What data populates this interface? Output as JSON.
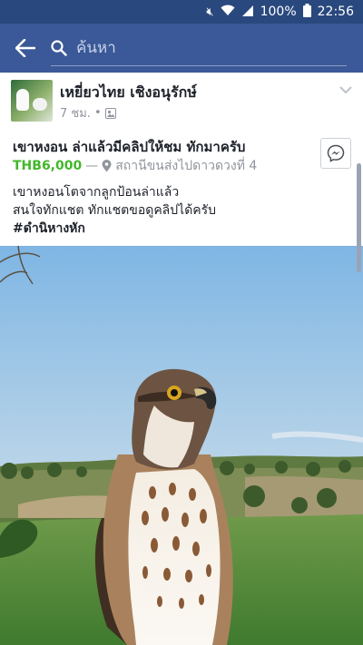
{
  "status_bar": {
    "battery": "100%",
    "time": "22:56",
    "icons": [
      "mute-icon",
      "wifi-icon",
      "signal-icon",
      "battery-icon"
    ]
  },
  "search": {
    "placeholder": "ค้นหา"
  },
  "post": {
    "author": "เหยี่ยวไทย เชิงอนุรักษ์",
    "time": "7 ชม.",
    "dot": "•",
    "title": "เขาหงอน ล่าแล้วมีคลิปให้ชม ทักมาครับ",
    "price": "THB6,000",
    "dash": "—",
    "location": "สถานีขนส่งไปดาวดวงที่ 4",
    "body_line1": "เขาหงอนโตจากลูกป้อนล่าแล้ว",
    "body_line2": "สนใจทักแชต ทักแชตขอดูคลิปได้ครับ",
    "hashtag": "#ดำนิหางหัก"
  },
  "colors": {
    "header": "#3b5998",
    "status": "#29487d",
    "price": "#42b72a"
  }
}
